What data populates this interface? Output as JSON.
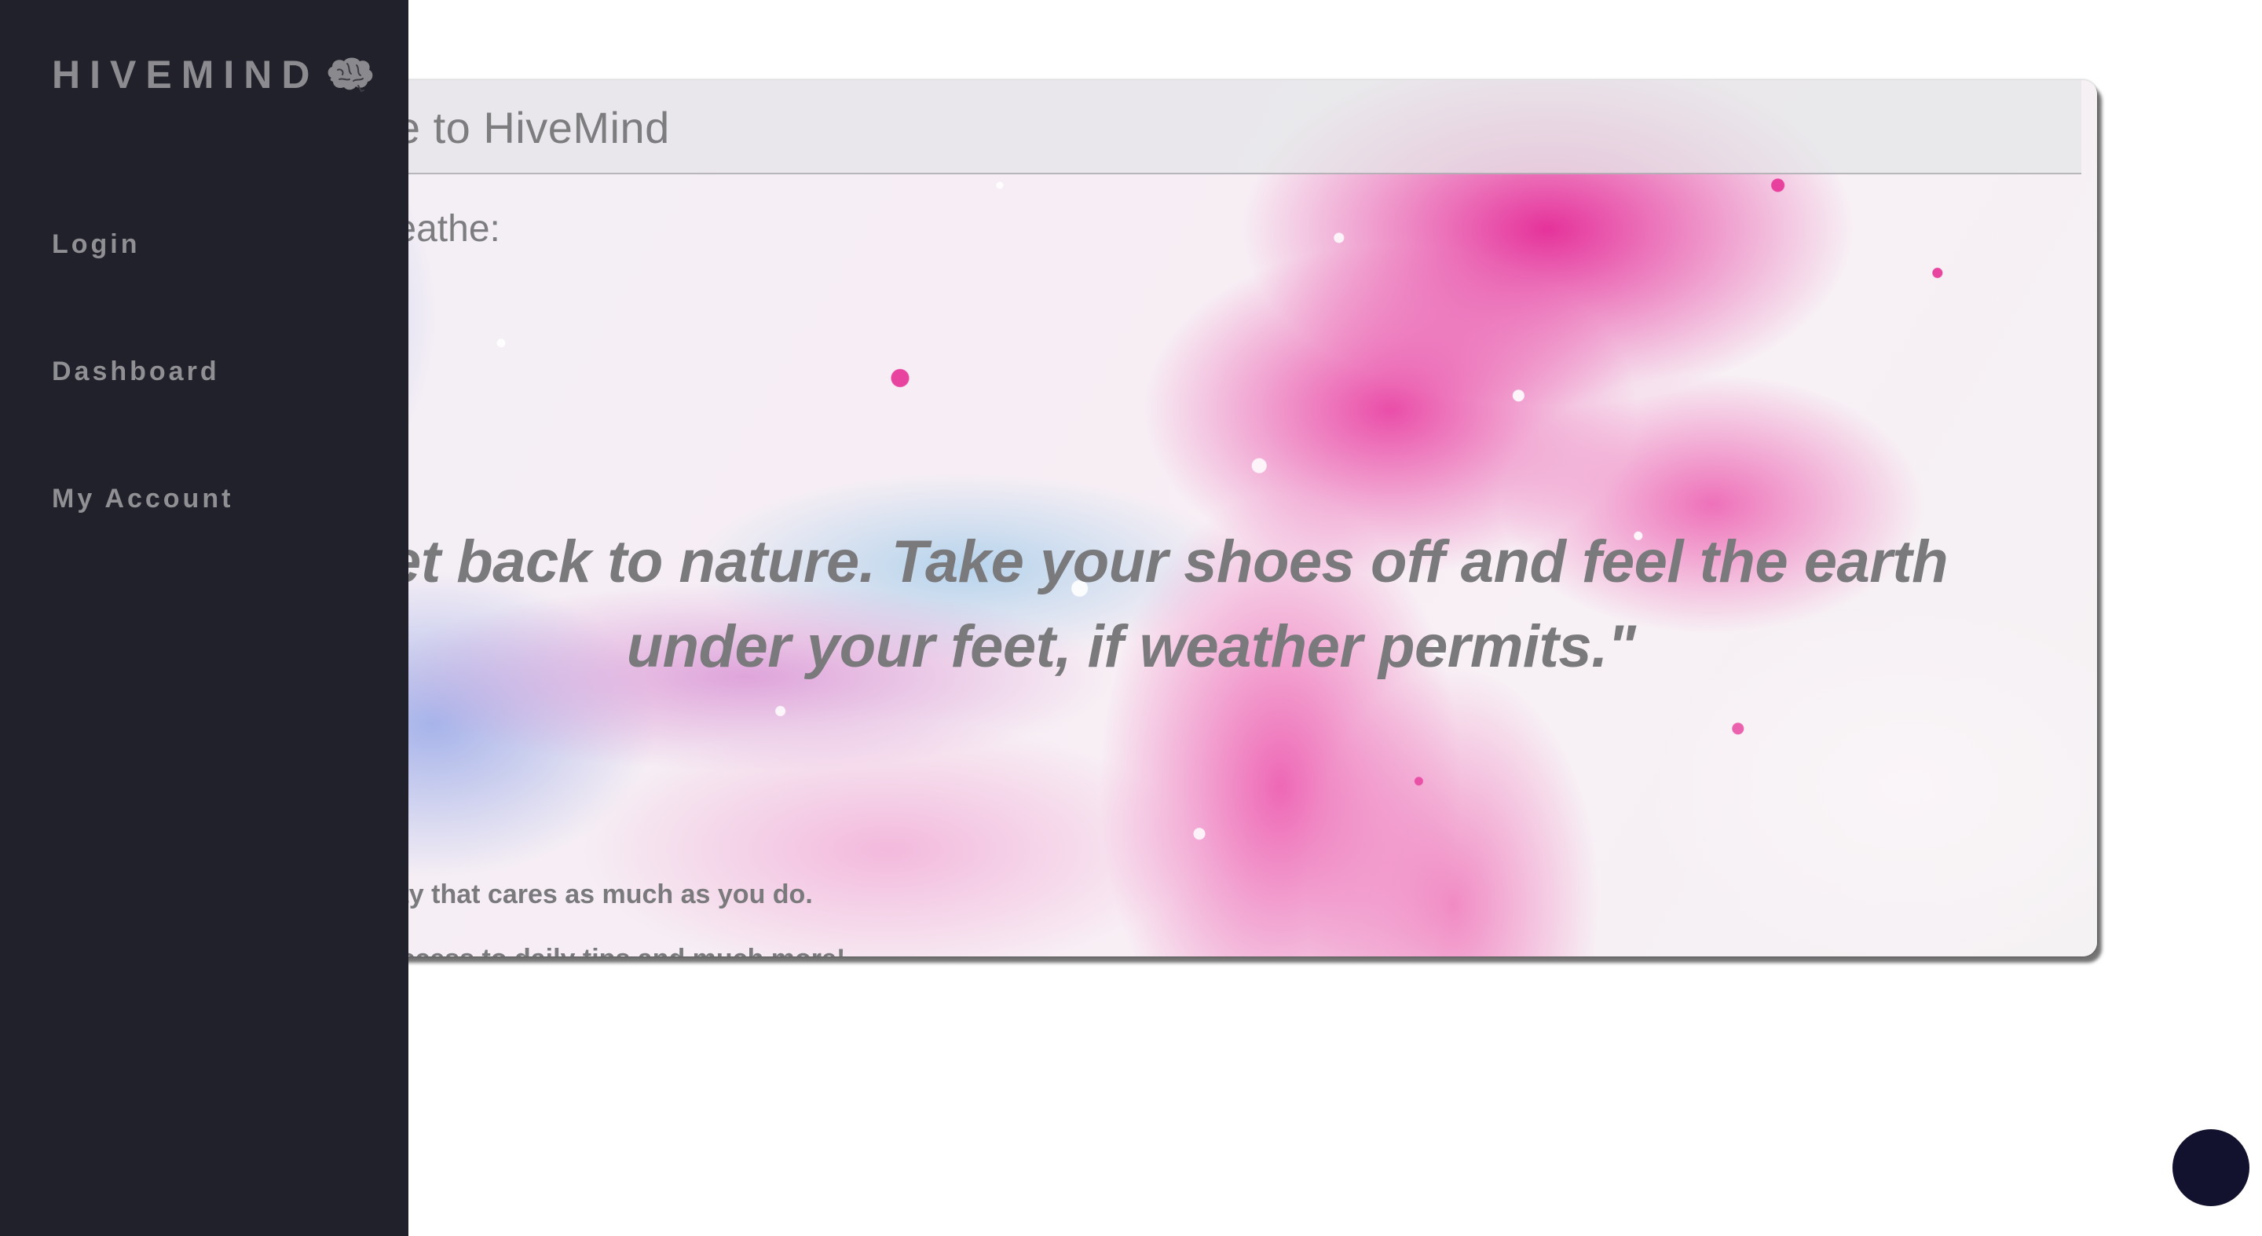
{
  "app": {
    "brand": "HIVEMIND",
    "brand_icon": "brain-icon"
  },
  "sidebar": {
    "items": [
      {
        "label": "Login"
      },
      {
        "label": "Dashboard"
      },
      {
        "label": "My Account"
      }
    ]
  },
  "main": {
    "title": "elcome to HiveMind",
    "subtitle": "eekly Breathe:",
    "quote": "\"Get back to nature. Take your shoes off and feel the earth under your feet, if weather permits.\"",
    "line1": "a community that cares as much as you do.",
    "line2": "in to gain access to daily tips and much more!"
  },
  "colors": {
    "sidebar_bg": "#20212b",
    "fab_bg": "#13122e",
    "accent_pink": "#e4289a"
  }
}
